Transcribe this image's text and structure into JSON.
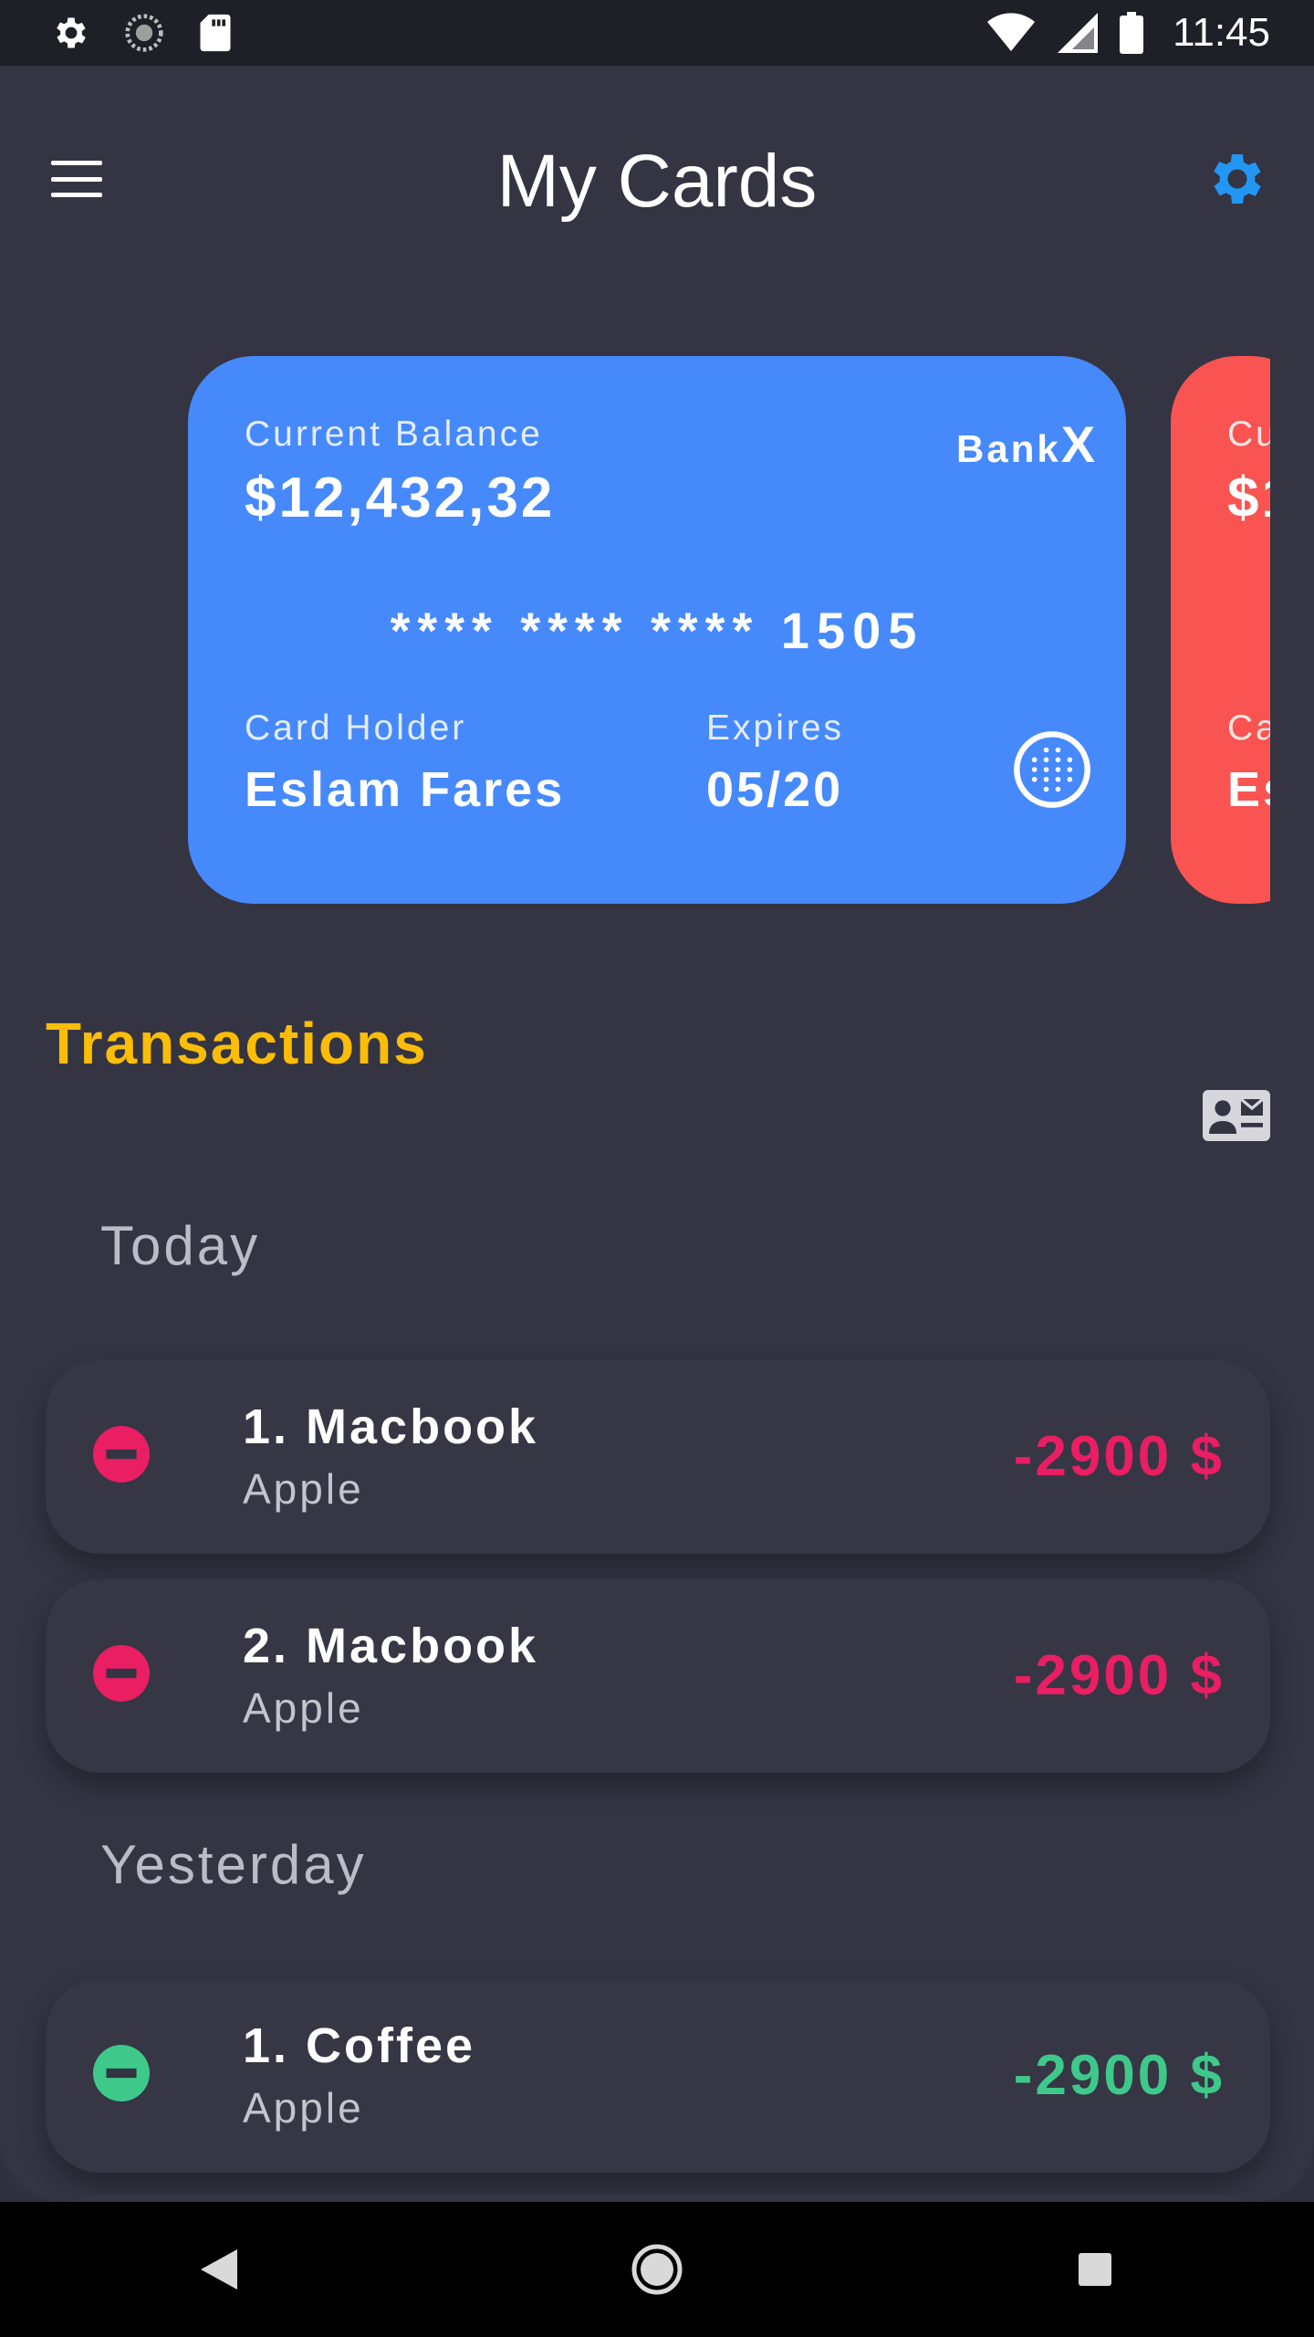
{
  "status_bar": {
    "time": "11:45",
    "left_icons": [
      "settings-icon",
      "sync-icon",
      "sd-card-icon"
    ],
    "right_icons": [
      "wifi-icon",
      "cell-signal-icon",
      "battery-icon"
    ]
  },
  "header": {
    "title": "My Cards",
    "menu_icon": "hamburger-menu-icon",
    "settings_icon": "gear-icon"
  },
  "cards": [
    {
      "balance_label": "Current Balance",
      "balance": "$12,432,32",
      "bank_name": "Bank",
      "bank_mark": "X",
      "number": "**** **** **** 1505",
      "holder_label": "Card Holder",
      "holder": "Eslam Fares",
      "expires_label": "Expires",
      "expires": "05/20",
      "color": "#4689fb"
    },
    {
      "balance_label": "Cu",
      "balance": "$1",
      "holder_label": "Ca",
      "holder": "Es",
      "color": "#f95451"
    }
  ],
  "transactions": {
    "title": "Transactions",
    "action_icon": "contact-card-icon",
    "groups": [
      {
        "day": "Today",
        "items": [
          {
            "name": "1. Macbook",
            "merchant": "Apple",
            "amount": "-2900 $",
            "status_color": "#e91e63"
          },
          {
            "name": "2. Macbook",
            "merchant": "Apple",
            "amount": "-2900 $",
            "status_color": "#e91e63"
          }
        ]
      },
      {
        "day": "Yesterday",
        "items": [
          {
            "name": "1. Coffee",
            "merchant": "Apple",
            "amount": "-2900 $",
            "status_color": "#3ec98a"
          }
        ]
      }
    ]
  },
  "colors": {
    "accent": "#fbbd08",
    "settings_blue": "#2196f3",
    "negative": "#e91e63",
    "positive": "#3ec98a"
  },
  "nav_bar": {
    "back_icon": "back-triangle-icon",
    "home_icon": "home-circle-icon",
    "recents_icon": "recents-square-icon"
  }
}
